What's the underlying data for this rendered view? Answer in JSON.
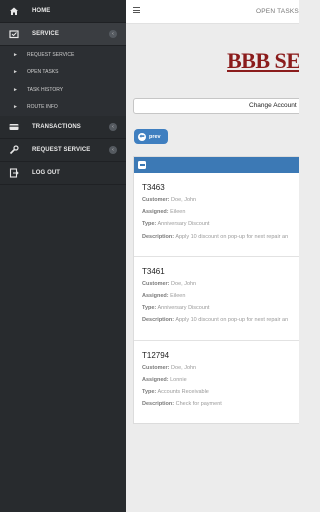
{
  "sidebar": {
    "items": [
      {
        "label": "HOME",
        "icon": "home-icon"
      },
      {
        "label": "SERVICE",
        "icon": "wrench-icon",
        "expanded": true
      },
      {
        "label": "TRANSACTIONS",
        "icon": "credit-card-icon"
      },
      {
        "label": "REQUEST SERVICE",
        "icon": "tools-icon"
      },
      {
        "label": "LOG OUT",
        "icon": "logout-icon"
      }
    ],
    "sub_items": [
      {
        "label": "REQUEST SERVICE"
      },
      {
        "label": "OPEN TASKS"
      },
      {
        "label": "TASK HISTORY"
      },
      {
        "label": "ROUTE INFO"
      }
    ],
    "chevron": "‹"
  },
  "header": {
    "title": "OPEN TASKS"
  },
  "main": {
    "logo_text": "BBB SE",
    "change_account_label": "Change Account",
    "prev_label": "prev",
    "tasks": [
      {
        "id": "T3463",
        "customer_label": "Customer:",
        "customer": "Doe, John",
        "assigned_label": "Assigned:",
        "assigned": "Eileen",
        "type_label": "Type:",
        "type": "Anniversary Discount",
        "description_label": "Description:",
        "description": "Apply 10 discount on pop-up for next repair an"
      },
      {
        "id": "T3461",
        "customer_label": "Customer:",
        "customer": "Doe, John",
        "assigned_label": "Assigned:",
        "assigned": "Eileen",
        "type_label": "Type:",
        "type": "Anniversary Discount",
        "description_label": "Description:",
        "description": "Apply 10 discount on pop-up for next repair an"
      },
      {
        "id": "T12794",
        "customer_label": "Customer:",
        "customer": "Doe, John",
        "assigned_label": "Assigned:",
        "assigned": "Lonnie",
        "type_label": "Type:",
        "type": "Accounts Receivable",
        "description_label": "Description:",
        "description": "Check for payment"
      }
    ]
  },
  "colors": {
    "sidebar_bg": "#282b2e",
    "accent_blue": "#3c79b5",
    "logo_red": "#8b1c1c"
  }
}
